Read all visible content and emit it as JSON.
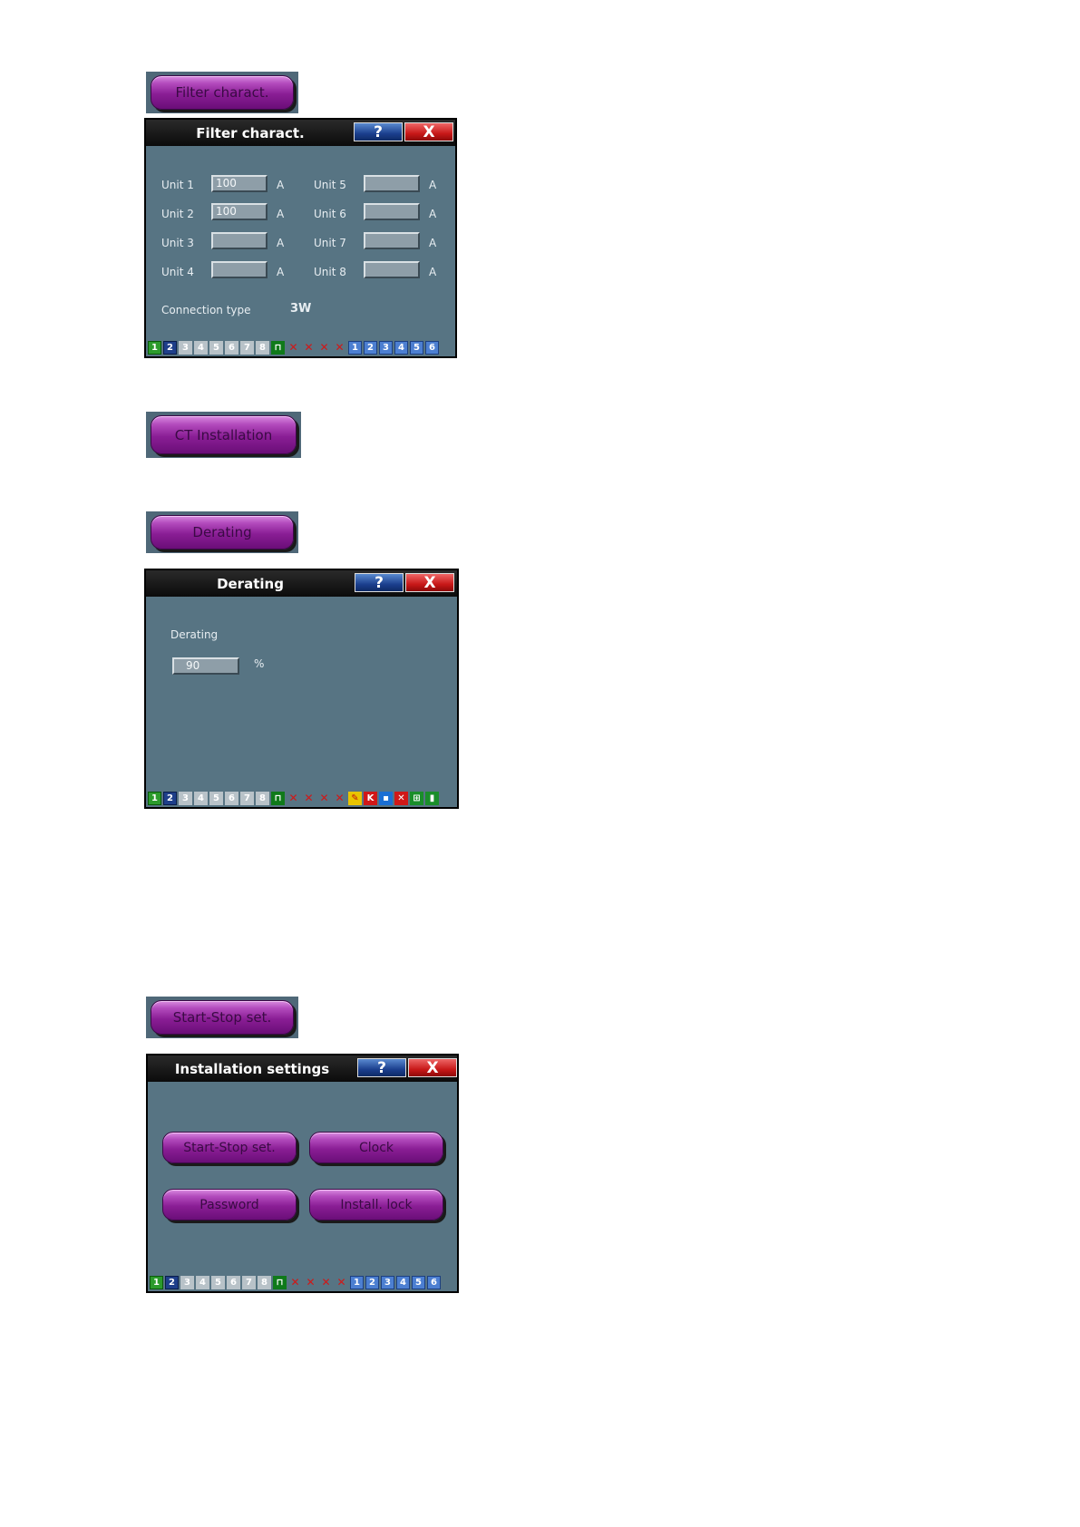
{
  "buttons": {
    "filter": "Filter charact.",
    "ct": "CT Installation",
    "derating": "Derating",
    "startstop": "Start-Stop set."
  },
  "icons": {
    "help": "?",
    "close": "X"
  },
  "filter_panel": {
    "title": "Filter charact.",
    "units_left": [
      {
        "label": "Unit 1",
        "value": "100",
        "unit": "A"
      },
      {
        "label": "Unit 2",
        "value": "100",
        "unit": "A"
      },
      {
        "label": "Unit 3",
        "value": "",
        "unit": "A"
      },
      {
        "label": "Unit 4",
        "value": "",
        "unit": "A"
      }
    ],
    "units_right": [
      {
        "label": "Unit 5",
        "value": "",
        "unit": "A"
      },
      {
        "label": "Unit 6",
        "value": "",
        "unit": "A"
      },
      {
        "label": "Unit 7",
        "value": "",
        "unit": "A"
      },
      {
        "label": "Unit 8",
        "value": "",
        "unit": "A"
      }
    ],
    "connection_label": "Connection type",
    "connection_value": "3W"
  },
  "derating_panel": {
    "title": "Derating",
    "label": "Derating",
    "value": "90",
    "unit": "%"
  },
  "install_panel": {
    "title": "Installation settings",
    "buttons": [
      "Start-Stop set.",
      "Clock",
      "Password",
      "Install. lock"
    ]
  },
  "statusbar": {
    "numbers": [
      "1",
      "2",
      "3",
      "4",
      "5",
      "6",
      "7",
      "8"
    ],
    "right_numbers": [
      "1",
      "2",
      "3",
      "4",
      "5",
      "6"
    ],
    "icon_names": [
      "unlock-icon",
      "link-broken-icon",
      "wrench-icon",
      "link-off-icon",
      "tool-off-icon"
    ]
  }
}
